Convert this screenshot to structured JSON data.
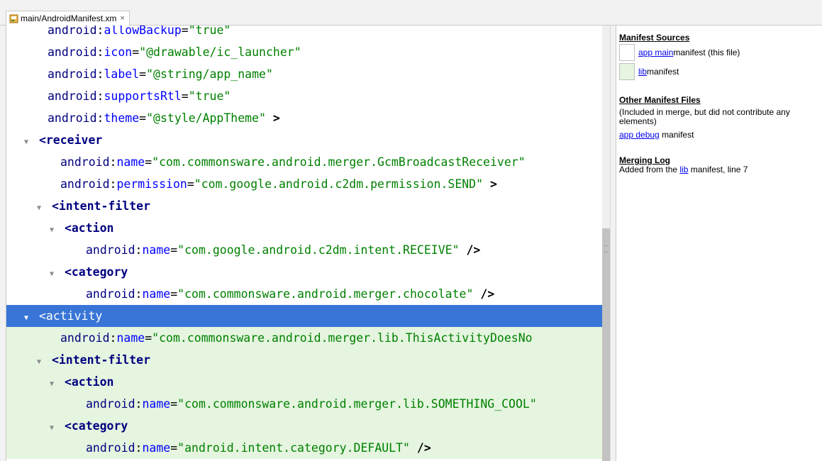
{
  "tab": {
    "label": "main/AndroidManifest.xm",
    "close": "×"
  },
  "editor": {
    "lines": [
      {
        "cls": "",
        "indent": 58,
        "arrow": "",
        "parts": [
          [
            "ns",
            "android"
          ],
          [
            "punct",
            ":"
          ],
          [
            "attr",
            "allowBackup"
          ],
          [
            "eq",
            "="
          ],
          [
            "val",
            "\"true\""
          ]
        ]
      },
      {
        "cls": "",
        "indent": 58,
        "arrow": "",
        "parts": [
          [
            "ns",
            "android"
          ],
          [
            "punct",
            ":"
          ],
          [
            "attr",
            "icon"
          ],
          [
            "eq",
            "="
          ],
          [
            "val",
            "\"@drawable/ic_launcher\""
          ]
        ]
      },
      {
        "cls": "",
        "indent": 58,
        "arrow": "",
        "parts": [
          [
            "ns",
            "android"
          ],
          [
            "punct",
            ":"
          ],
          [
            "attr",
            "label"
          ],
          [
            "eq",
            "="
          ],
          [
            "val",
            "\"@string/app_name\""
          ]
        ]
      },
      {
        "cls": "",
        "indent": 58,
        "arrow": "",
        "parts": [
          [
            "ns",
            "android"
          ],
          [
            "punct",
            ":"
          ],
          [
            "attr",
            "supportsRtl"
          ],
          [
            "eq",
            "="
          ],
          [
            "val",
            "\"true\""
          ]
        ]
      },
      {
        "cls": "",
        "indent": 58,
        "arrow": "",
        "parts": [
          [
            "ns",
            "android"
          ],
          [
            "punct",
            ":"
          ],
          [
            "attr",
            "theme"
          ],
          [
            "eq",
            "="
          ],
          [
            "val",
            "\"@style/AppTheme\""
          ],
          [
            "brk",
            " >"
          ]
        ]
      },
      {
        "cls": "",
        "indent": 38,
        "arrow": "▼",
        "parts": [
          [
            "tag",
            "<receiver"
          ]
        ]
      },
      {
        "cls": "",
        "indent": 76,
        "arrow": "",
        "parts": [
          [
            "ns",
            "android"
          ],
          [
            "punct",
            ":"
          ],
          [
            "attr",
            "name"
          ],
          [
            "eq",
            "="
          ],
          [
            "val",
            "\"com.commonsware.android.merger.GcmBroadcastReceiver\""
          ]
        ]
      },
      {
        "cls": "",
        "indent": 76,
        "arrow": "",
        "parts": [
          [
            "ns",
            "android"
          ],
          [
            "punct",
            ":"
          ],
          [
            "attr",
            "permission"
          ],
          [
            "eq",
            "="
          ],
          [
            "val",
            "\"com.google.android.c2dm.permission.SEND\""
          ],
          [
            "brk",
            " >"
          ]
        ]
      },
      {
        "cls": "",
        "indent": 56,
        "arrow": "▼",
        "parts": [
          [
            "tag",
            "<intent-filter"
          ]
        ]
      },
      {
        "cls": "",
        "indent": 74,
        "arrow": "▼",
        "parts": [
          [
            "tag",
            "<action"
          ]
        ]
      },
      {
        "cls": "",
        "indent": 112,
        "arrow": "",
        "parts": [
          [
            "ns",
            "android"
          ],
          [
            "punct",
            ":"
          ],
          [
            "attr",
            "name"
          ],
          [
            "eq",
            "="
          ],
          [
            "val",
            "\"com.google.android.c2dm.intent.RECEIVE\""
          ],
          [
            "brk",
            " />"
          ]
        ]
      },
      {
        "cls": "",
        "indent": 74,
        "arrow": "▼",
        "parts": [
          [
            "tag",
            "<category"
          ]
        ]
      },
      {
        "cls": "",
        "indent": 112,
        "arrow": "",
        "parts": [
          [
            "ns",
            "android"
          ],
          [
            "punct",
            ":"
          ],
          [
            "attr",
            "name"
          ],
          [
            "eq",
            "="
          ],
          [
            "val",
            "\"com.commonsware.android.merger.chocolate\""
          ],
          [
            "brk",
            " />"
          ]
        ]
      },
      {
        "cls": "sel",
        "indent": 38,
        "arrow": "▼",
        "parts": [
          [
            "tag",
            "<activity"
          ]
        ]
      },
      {
        "cls": "green",
        "indent": 76,
        "arrow": "",
        "parts": [
          [
            "ns",
            "android"
          ],
          [
            "punct",
            ":"
          ],
          [
            "attr",
            "name"
          ],
          [
            "eq",
            "="
          ],
          [
            "val",
            "\"com.commonsware.android.merger.lib.ThisActivityDoesNo"
          ]
        ]
      },
      {
        "cls": "green",
        "indent": 56,
        "arrow": "▼",
        "parts": [
          [
            "tag",
            "<intent-filter"
          ]
        ]
      },
      {
        "cls": "green",
        "indent": 74,
        "arrow": "▼",
        "parts": [
          [
            "tag",
            "<action"
          ]
        ]
      },
      {
        "cls": "green",
        "indent": 112,
        "arrow": "",
        "parts": [
          [
            "ns",
            "android"
          ],
          [
            "punct",
            ":"
          ],
          [
            "attr",
            "name"
          ],
          [
            "eq",
            "="
          ],
          [
            "val",
            "\"com.commonsware.android.merger.lib.SOMETHING_COOL\""
          ]
        ]
      },
      {
        "cls": "green",
        "indent": 74,
        "arrow": "▼",
        "parts": [
          [
            "tag",
            "<category"
          ]
        ]
      },
      {
        "cls": "green",
        "indent": 112,
        "arrow": "",
        "parts": [
          [
            "ns",
            "android"
          ],
          [
            "punct",
            ":"
          ],
          [
            "attr",
            "name"
          ],
          [
            "eq",
            "="
          ],
          [
            "val",
            "\"android.intent.category.DEFAULT\""
          ],
          [
            "brk",
            " />"
          ]
        ]
      }
    ]
  },
  "side": {
    "sources_title": "Manifest Sources",
    "main_link": "app main",
    "main_suffix": " manifest (this file)",
    "lib_link": "lib",
    "lib_suffix": " manifest",
    "other_title": "Other Manifest Files",
    "other_desc": "(Included in merge, but did not contribute any elements)",
    "debug_link": "app debug",
    "debug_suffix": " manifest",
    "log_title": "Merging Log",
    "log_prefix": "Added from the ",
    "log_link": "lib",
    "log_suffix": " manifest, line 7"
  },
  "colors": {
    "selection": "#3875d7",
    "lib_highlight": "#e5f5df",
    "tag": "#000080",
    "attr": "#0000ff",
    "value": "#008000"
  }
}
